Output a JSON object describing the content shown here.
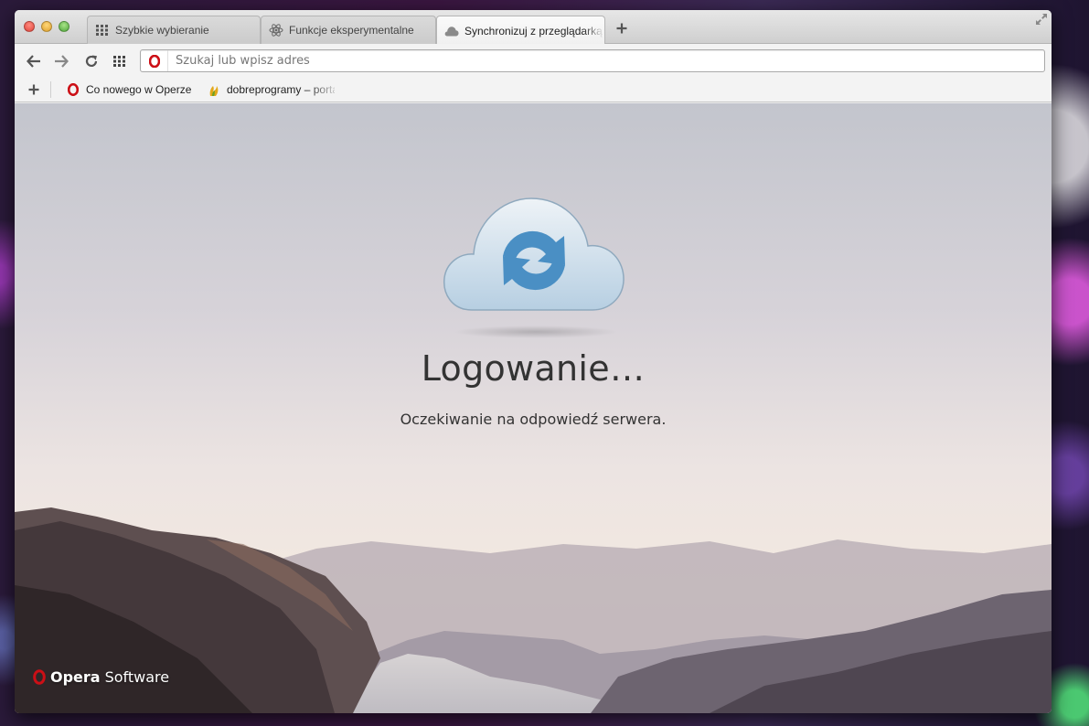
{
  "tabs": [
    {
      "label": "Szybkie wybieranie",
      "icon": "speed-dial-grid-icon",
      "active": false
    },
    {
      "label": "Funkcje eksperymentalne",
      "icon": "atom-icon",
      "active": false
    },
    {
      "label": "Synchronizuj z przeglądarką",
      "icon": "cloud-icon",
      "active": true
    }
  ],
  "toolbar": {
    "address_placeholder": "Szukaj lub wpisz adres",
    "address_value": ""
  },
  "bookmarks": [
    {
      "label": "Co nowego w Operze",
      "icon": "opera-logo-icon"
    },
    {
      "label": "dobreprogramy – portal",
      "icon": "dobreprogramy-logo-icon"
    }
  ],
  "content": {
    "title": "Logowanie…",
    "subtitle": "Oczekiwanie na odpowiedź serwera.",
    "brand_bold": "Opera",
    "brand_regular": "Software"
  },
  "colors": {
    "opera_red": "#cc0f16",
    "sync_blue": "#4a8fc4",
    "cloud_fill": "#cfe0ec"
  }
}
